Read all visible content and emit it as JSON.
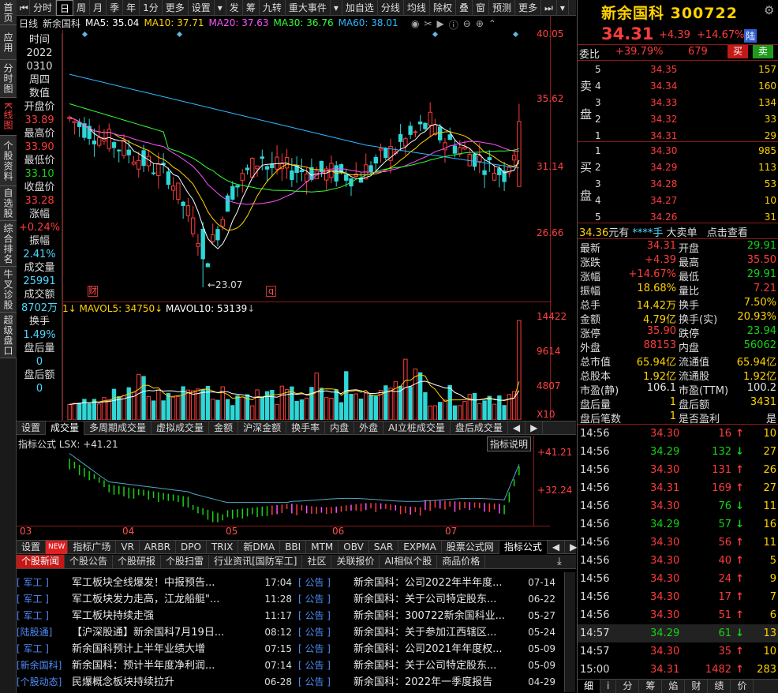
{
  "sidebar": [
    "首页",
    "应用",
    "分时图",
    "K线图",
    "个股资料",
    "自选股",
    "综合排名",
    "牛叉诊股",
    "超级盘口"
  ],
  "toolbar": {
    "items": [
      "分时",
      "日",
      "周",
      "月",
      "季",
      "年",
      "1分",
      "更多",
      "设置",
      "发",
      "筹",
      "九转",
      "重大事件",
      "加自选",
      "分线",
      "均线",
      "除权",
      "叠",
      "窗",
      "预测",
      "更多"
    ],
    "active": "日"
  },
  "legend": {
    "period": "日线",
    "name": "新余国科",
    "ma5": "MA5: 35.04",
    "ma10": "MA10: 37.71",
    "ma20": "MA20: 37.63",
    "ma30": "MA30: 36.76",
    "ma60": "MA60: 38.01"
  },
  "colors": {
    "ma5": "#ffffff",
    "ma10": "#ffd200",
    "ma20": "#ff50ff",
    "ma30": "#33ff33",
    "ma60": "#2fb7ff",
    "up": "#ff3b3b",
    "down": "#2fd6d6"
  },
  "info_panel": [
    {
      "label": "时间",
      "value": "2022"
    },
    {
      "label": "",
      "value": "0310"
    },
    {
      "label": "周四",
      "value": "数值"
    },
    {
      "label": "开盘价",
      "value": "33.89"
    },
    {
      "label": "最高价",
      "value": "33.90"
    },
    {
      "label": "最低价",
      "value": "33.10"
    },
    {
      "label": "收盘价",
      "value": "33.28"
    },
    {
      "label": "涨幅",
      "value": "+0.24%"
    },
    {
      "label": "振幅",
      "value": "2.41%"
    },
    {
      "label": "成交量",
      "value": "25991"
    },
    {
      "label": "成交额",
      "value": "8702万"
    },
    {
      "label": "换手",
      "value": "1.49%"
    },
    {
      "label": "盘后量",
      "value": "0"
    },
    {
      "label": "盘后额",
      "value": "0"
    }
  ],
  "price_axis": [
    "40.05",
    "35.62",
    "31.14",
    "26.66"
  ],
  "low_label": "←23.07",
  "markers": {
    "cai": "财",
    "q": "q"
  },
  "volume": {
    "legend_mavol5": "MAVOL5: 34750",
    "legend_mavol10": "MAVOL10: 53139",
    "axis": [
      "14422",
      "9614",
      "4807",
      "X10"
    ]
  },
  "tabs1": [
    "设置",
    "成交量",
    "多周期成交量",
    "虚拟成交量",
    "金额",
    "沪深金额",
    "换手率",
    "内盘",
    "外盘",
    "AI立桩成交量",
    "盘后成交量"
  ],
  "tabs1_active": "成交量",
  "indicator": {
    "title": "指标公式 LSX: +41.21",
    "help": "指标说明",
    "axis": [
      "+41.21",
      "+32.24"
    ]
  },
  "months": [
    "03",
    "04",
    "05",
    "06",
    "07"
  ],
  "tabs2": [
    "设置",
    "NEW",
    "指标广场",
    "VR",
    "ARBR",
    "DPO",
    "TRIX",
    "新DMA",
    "BBI",
    "MTM",
    "OBV",
    "SAR",
    "EXPMA",
    "股票公式网",
    "指标公式"
  ],
  "tabs2_active": "指标公式",
  "news_tabs": [
    "个股新闻",
    "个股公告",
    "个股研报",
    "个股扫雷",
    "行业资讯[国防军工]",
    "社区",
    "关联报价",
    "AI相似个股",
    "商品价格"
  ],
  "news_left": [
    {
      "tag": "[ 军工 ]",
      "title": "军工板块全线爆发！中报预告...",
      "time": "17:04"
    },
    {
      "tag": "[ 军工 ]",
      "title": "军工板块发力走高，江龙船艇\"...",
      "time": "11:28"
    },
    {
      "tag": "[ 军工 ]",
      "title": "军工板块持续走强",
      "time": "11:17"
    },
    {
      "tag": "[陆股通]",
      "title": "【沪深股通】新余国科7月19日...",
      "time": "08:12"
    },
    {
      "tag": "[ 军工 ]",
      "title": "新余国科预计上半年业绩大增",
      "time": "07:15"
    },
    {
      "tag": "[新余国科]",
      "title": "新余国科：预计半年度净利润...",
      "time": "07:14"
    },
    {
      "tag": "[个股动态]",
      "title": "民爆概念板块持续拉升",
      "time": "06-28"
    }
  ],
  "news_right": [
    {
      "tag": "[ 公告 ]",
      "title": "新余国科：公司2022年半年度...",
      "time": "07-14"
    },
    {
      "tag": "[ 公告 ]",
      "title": "新余国科：关于公司特定股东...",
      "time": "06-22"
    },
    {
      "tag": "[ 公告 ]",
      "title": "新余国科：300722新余国科业...",
      "time": "05-27"
    },
    {
      "tag": "[ 公告 ]",
      "title": "新余国科：关于参加江西辖区...",
      "time": "05-24"
    },
    {
      "tag": "[ 公告 ]",
      "title": "新余国科：公司2021年年度权...",
      "time": "05-09"
    },
    {
      "tag": "[ 公告 ]",
      "title": "新余国科：关于公司特定股东...",
      "time": "05-09"
    },
    {
      "tag": "[ 公告 ]",
      "title": "新余国科：2022年一季度报告",
      "time": "04-29"
    }
  ],
  "stock": {
    "name": "新余国科 300722",
    "price": "34.31",
    "change": "+4.39",
    "pct": "+14.67%",
    "badge": "陆"
  },
  "weibi": {
    "label": "委比",
    "pct": "+39.79%",
    "diff": "679",
    "buy": "买",
    "sell": "卖"
  },
  "asks": [
    {
      "lvl": "5",
      "price": "34.35",
      "vol": "157"
    },
    {
      "lvl": "4",
      "price": "34.34",
      "vol": "160"
    },
    {
      "lvl": "3",
      "price": "34.33",
      "vol": "134"
    },
    {
      "lvl": "2",
      "price": "34.32",
      "vol": "33"
    },
    {
      "lvl": "1",
      "price": "34.31",
      "vol": "29"
    }
  ],
  "bids": [
    {
      "lvl": "1",
      "price": "34.30",
      "vol": "985"
    },
    {
      "lvl": "2",
      "price": "34.29",
      "vol": "113"
    },
    {
      "lvl": "3",
      "price": "34.28",
      "vol": "53"
    },
    {
      "lvl": "4",
      "price": "34.27",
      "vol": "10"
    },
    {
      "lvl": "5",
      "price": "34.26",
      "vol": "31"
    }
  ],
  "ask_side": [
    "卖",
    "盘"
  ],
  "bid_side": [
    "买",
    "盘"
  ],
  "ad": {
    "price": "34.36",
    "unit": "元有",
    "stars": "****手",
    "tag": "大卖单",
    "link": "点击查看"
  },
  "quote": [
    {
      "l": "最新",
      "v": "34.31",
      "l2": "开盘",
      "v2": "29.91",
      "c1": "red",
      "c2": "green"
    },
    {
      "l": "涨跌",
      "v": "+4.39",
      "l2": "最高",
      "v2": "35.50",
      "c1": "red",
      "c2": "red"
    },
    {
      "l": "涨幅",
      "v": "+14.67%",
      "l2": "最低",
      "v2": "29.91",
      "c1": "red",
      "c2": "green"
    },
    {
      "l": "振幅",
      "v": "18.68%",
      "l2": "量比",
      "v2": "7.21",
      "c1": "yellow",
      "c2": "red"
    },
    {
      "l": "总手",
      "v": "14.42万",
      "l2": "换手",
      "v2": "7.50%",
      "c1": "yellow",
      "c2": "yellow"
    },
    {
      "l": "金额",
      "v": "4.79亿",
      "l2": "换手(实)",
      "v2": "20.93%",
      "c1": "yellow",
      "c2": "yellow"
    },
    {
      "l": "涨停",
      "v": "35.90",
      "l2": "跌停",
      "v2": "23.94",
      "c1": "red",
      "c2": "green"
    },
    {
      "l": "外盘",
      "v": "88153",
      "l2": "内盘",
      "v2": "56062",
      "c1": "red",
      "c2": "green"
    },
    {
      "l": "总市值",
      "v": "65.94亿",
      "l2": "流通值",
      "v2": "65.94亿",
      "c1": "yellow",
      "c2": "yellow"
    },
    {
      "l": "总股本",
      "v": "1.92亿",
      "l2": "流通股",
      "v2": "1.92亿",
      "c1": "yellow",
      "c2": "yellow"
    },
    {
      "l": "市盈(静)",
      "v": "106.1",
      "l2": "市盈(TTM)",
      "v2": "100.2",
      "c1": "white",
      "c2": "white"
    },
    {
      "l": "盘后量",
      "v": "1",
      "l2": "盘后额",
      "v2": "3431",
      "c1": "yellow",
      "c2": "yellow"
    },
    {
      "l": "盘后笔数",
      "v": "1",
      "l2": "是否盈利",
      "v2": "是",
      "c1": "yellow",
      "c2": "white"
    }
  ],
  "ticks": [
    {
      "t": "14:56",
      "p": "34.30",
      "v": "16",
      "dir": "up",
      "n": "10"
    },
    {
      "t": "14:56",
      "p": "34.29",
      "v": "132",
      "dir": "down",
      "n": "27"
    },
    {
      "t": "14:56",
      "p": "34.30",
      "v": "131",
      "dir": "up",
      "n": "26"
    },
    {
      "t": "14:56",
      "p": "34.31",
      "v": "169",
      "dir": "up",
      "n": "27"
    },
    {
      "t": "14:56",
      "p": "34.30",
      "v": "76",
      "dir": "down",
      "n": "11"
    },
    {
      "t": "14:56",
      "p": "34.29",
      "v": "57",
      "dir": "down",
      "n": "16"
    },
    {
      "t": "14:56",
      "p": "34.30",
      "v": "56",
      "dir": "up",
      "n": "11"
    },
    {
      "t": "14:56",
      "p": "34.30",
      "v": "40",
      "dir": "up",
      "n": "5"
    },
    {
      "t": "14:56",
      "p": "34.30",
      "v": "24",
      "dir": "up",
      "n": "9"
    },
    {
      "t": "14:56",
      "p": "34.30",
      "v": "17",
      "dir": "up",
      "n": "7"
    },
    {
      "t": "14:56",
      "p": "34.30",
      "v": "51",
      "dir": "up",
      "n": "6"
    },
    {
      "t": "14:57",
      "p": "34.29",
      "v": "61",
      "dir": "down",
      "n": "13"
    },
    {
      "t": "14:57",
      "p": "34.30",
      "v": "35",
      "dir": "up",
      "n": "10"
    },
    {
      "t": "15:00",
      "p": "34.31",
      "v": "1482",
      "dir": "up",
      "n": "283"
    }
  ],
  "bottom_tabs": [
    "细",
    "i",
    "分",
    "筹",
    "焰",
    "财",
    "绩",
    "价"
  ]
}
